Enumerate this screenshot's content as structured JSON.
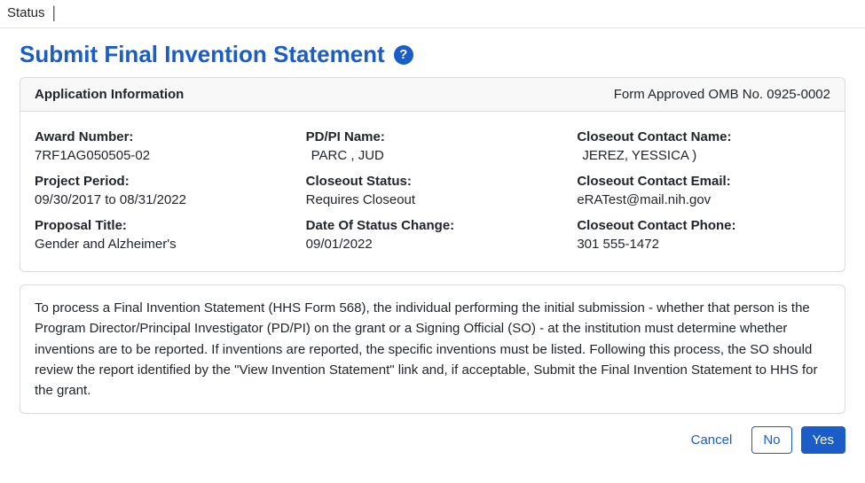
{
  "breadcrumb": {
    "current": "Status"
  },
  "page": {
    "title": "Submit Final Invention Statement"
  },
  "appInfo": {
    "header_title": "Application Information",
    "form_approved": "Form Approved OMB No. 0925-0002",
    "award_number_label": "Award Number:",
    "award_number": "7RF1AG050505-02",
    "project_period_label": "Project Period:",
    "project_period": "09/30/2017 to 08/31/2022",
    "proposal_title_label": "Proposal Title:",
    "proposal_title": "Gender and Alzheimer's",
    "pdpi_name_label": "PD/PI Name:",
    "pdpi_name": "PARC , JUD",
    "closeout_status_label": "Closeout Status:",
    "closeout_status": "Requires Closeout",
    "date_status_change_label": "Date Of Status Change:",
    "date_status_change": "09/01/2022",
    "closeout_contact_name_label": "Closeout Contact Name:",
    "closeout_contact_name": "JEREZ, YESSICA )",
    "closeout_contact_email_label": "Closeout Contact Email:",
    "closeout_contact_email": "eRATest@mail.nih.gov",
    "closeout_contact_phone_label": "Closeout Contact Phone:",
    "closeout_contact_phone": "301 555-1472"
  },
  "instructions": "To process a Final Invention Statement (HHS Form 568), the individual performing the initial submission - whether that person is the Program Director/Principal Investigator (PD/PI) on the grant or a Signing Official (SO) - at the institution must determine whether inventions are to be reported. If inventions are reported, the specific inventions must be listed. Following this process, the SO should review the report identified by the \"View Invention Statement\" link and, if acceptable, Submit the Final Invention Statement to HHS for the grant.",
  "actions": {
    "cancel_label": "Cancel",
    "no_label": "No",
    "yes_label": "Yes"
  }
}
